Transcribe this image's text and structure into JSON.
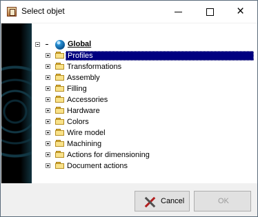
{
  "window": {
    "title": "Select objet",
    "controls": {
      "minimize": "minimize-icon",
      "maximize": "maximize-icon",
      "close": "×"
    }
  },
  "tree": {
    "root": {
      "label": "Global",
      "icon": "globe-icon",
      "expanded": true
    },
    "items": [
      {
        "label": "Profiles",
        "selected": true
      },
      {
        "label": "Transformations"
      },
      {
        "label": "Assembly"
      },
      {
        "label": "Filling"
      },
      {
        "label": "Accessories"
      },
      {
        "label": "Hardware"
      },
      {
        "label": "Colors"
      },
      {
        "label": "Wire model"
      },
      {
        "label": "Machining"
      },
      {
        "label": "Actions for dimensioning"
      },
      {
        "label": "Document actions"
      }
    ]
  },
  "buttons": {
    "cancel": {
      "label": "Cancel",
      "icon": "cancel-icon"
    },
    "ok": {
      "label": "OK",
      "enabled": false
    }
  },
  "colors": {
    "selection": "#000080",
    "folder": "#f9e28a"
  }
}
